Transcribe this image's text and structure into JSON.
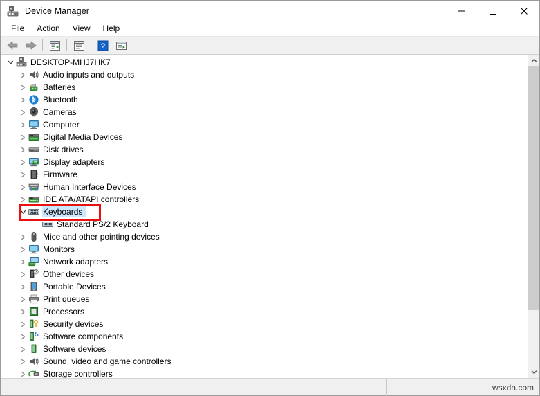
{
  "window": {
    "title": "Device Manager",
    "title_icon": "device-manager-icon",
    "buttons": {
      "minimize": "minimize-icon",
      "maximize": "maximize-icon",
      "close": "close-icon"
    }
  },
  "menubar": {
    "items": [
      {
        "label": "File"
      },
      {
        "label": "Action"
      },
      {
        "label": "View"
      },
      {
        "label": "Help"
      }
    ]
  },
  "toolbar": {
    "items": [
      {
        "name": "back-button",
        "icon": "back-arrow-icon"
      },
      {
        "name": "forward-button",
        "icon": "forward-arrow-icon"
      },
      {
        "name": "separator-1",
        "icon": "separator"
      },
      {
        "name": "show-hide-console-tree-button",
        "icon": "console-tree-icon"
      },
      {
        "name": "separator-2",
        "icon": "separator"
      },
      {
        "name": "properties-button",
        "icon": "properties-icon"
      },
      {
        "name": "separator-3",
        "icon": "separator"
      },
      {
        "name": "help-button",
        "icon": "help-question-icon"
      },
      {
        "name": "scan-hardware-changes-button",
        "icon": "scan-hardware-icon"
      }
    ]
  },
  "tree": {
    "nodes": [
      {
        "label": "DESKTOP-MHJ7HK7",
        "depth": 0,
        "state": "expanded",
        "icon": "computer-root-icon",
        "selected": false
      },
      {
        "label": "Audio inputs and outputs",
        "depth": 1,
        "state": "collapsed",
        "icon": "speaker-icon",
        "selected": false
      },
      {
        "label": "Batteries",
        "depth": 1,
        "state": "collapsed",
        "icon": "battery-icon",
        "selected": false
      },
      {
        "label": "Bluetooth",
        "depth": 1,
        "state": "collapsed",
        "icon": "bluetooth-icon",
        "selected": false
      },
      {
        "label": "Cameras",
        "depth": 1,
        "state": "collapsed",
        "icon": "camera-icon",
        "selected": false
      },
      {
        "label": "Computer",
        "depth": 1,
        "state": "collapsed",
        "icon": "monitor-icon",
        "selected": false
      },
      {
        "label": "Digital Media Devices",
        "depth": 1,
        "state": "collapsed",
        "icon": "media-device-icon",
        "selected": false
      },
      {
        "label": "Disk drives",
        "depth": 1,
        "state": "collapsed",
        "icon": "disk-drive-icon",
        "selected": false
      },
      {
        "label": "Display adapters",
        "depth": 1,
        "state": "collapsed",
        "icon": "display-adapter-icon",
        "selected": false
      },
      {
        "label": "Firmware",
        "depth": 1,
        "state": "collapsed",
        "icon": "firmware-chip-icon",
        "selected": false
      },
      {
        "label": "Human Interface Devices",
        "depth": 1,
        "state": "collapsed",
        "icon": "hid-icon",
        "selected": false
      },
      {
        "label": "IDE ATA/ATAPI controllers",
        "depth": 1,
        "state": "collapsed",
        "icon": "ide-controller-icon",
        "selected": false
      },
      {
        "label": "Keyboards",
        "depth": 1,
        "state": "expanded",
        "icon": "keyboard-icon",
        "selected": true
      },
      {
        "label": "Standard PS/2 Keyboard",
        "depth": 2,
        "state": "leaf",
        "icon": "keyboard-icon",
        "selected": false
      },
      {
        "label": "Mice and other pointing devices",
        "depth": 1,
        "state": "collapsed",
        "icon": "mouse-icon",
        "selected": false
      },
      {
        "label": "Monitors",
        "depth": 1,
        "state": "collapsed",
        "icon": "monitor-icon",
        "selected": false
      },
      {
        "label": "Network adapters",
        "depth": 1,
        "state": "collapsed",
        "icon": "network-adapter-icon",
        "selected": false
      },
      {
        "label": "Other devices",
        "depth": 1,
        "state": "collapsed",
        "icon": "other-device-icon",
        "selected": false
      },
      {
        "label": "Portable Devices",
        "depth": 1,
        "state": "collapsed",
        "icon": "portable-device-icon",
        "selected": false
      },
      {
        "label": "Print queues",
        "depth": 1,
        "state": "collapsed",
        "icon": "printer-icon",
        "selected": false
      },
      {
        "label": "Processors",
        "depth": 1,
        "state": "collapsed",
        "icon": "processor-icon",
        "selected": false
      },
      {
        "label": "Security devices",
        "depth": 1,
        "state": "collapsed",
        "icon": "security-device-icon",
        "selected": false
      },
      {
        "label": "Software components",
        "depth": 1,
        "state": "collapsed",
        "icon": "software-component-icon",
        "selected": false
      },
      {
        "label": "Software devices",
        "depth": 1,
        "state": "collapsed",
        "icon": "software-device-icon",
        "selected": false
      },
      {
        "label": "Sound, video and game controllers",
        "depth": 1,
        "state": "collapsed",
        "icon": "speaker-icon",
        "selected": false
      },
      {
        "label": "Storage controllers",
        "depth": 1,
        "state": "collapsed",
        "icon": "storage-controller-icon",
        "selected": false
      }
    ]
  },
  "scrollbar": {
    "up_arrow": "chevron-up-icon",
    "down_arrow": "chevron-down-icon",
    "thumb_position": "top"
  },
  "statusbar": {
    "panel1": "",
    "panel2": "",
    "watermark": "wsxdn.com"
  },
  "annotation": {
    "target": "Keyboards",
    "color": "#e8110f",
    "shape": "rectangle"
  },
  "colors": {
    "selection": "#cce8ff",
    "annotation": "#e8110f",
    "chrome": "#f0f0f0",
    "scrollbar_thumb": "#cdcdcd"
  }
}
